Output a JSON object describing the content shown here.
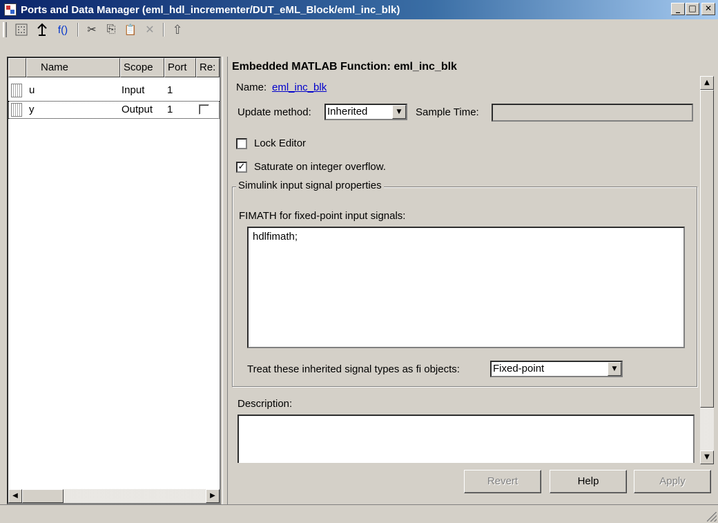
{
  "window": {
    "title": "Ports and Data Manager (eml_hdl_incrementer/DUT_eML_Block/eml_inc_blk)",
    "minimize": "_",
    "maximize": "□",
    "close": "✕"
  },
  "toolbar": {
    "grip_icon": "toolbar-grip",
    "add_data_icon": "add-data-icon",
    "add_signal_icon": "add-port-icon",
    "function_label": "f()",
    "cut_icon": "✂",
    "copy_icon": "⎘",
    "paste_icon": "📋",
    "delete_icon": "✕",
    "up_icon": "⇧"
  },
  "grid": {
    "columns": [
      "Name",
      "Scope",
      "Port",
      "Re:"
    ],
    "rows": [
      {
        "name": "u",
        "scope": "Input",
        "port": "1",
        "resolve": false
      },
      {
        "name": "y",
        "scope": "Output",
        "port": "1",
        "resolve": false
      }
    ]
  },
  "panel": {
    "title": "Embedded MATLAB Function: eml_inc_blk",
    "name_label": "Name:",
    "name_value": "eml_inc_blk",
    "update_method_label": "Update method:",
    "update_method_value": "Inherited",
    "sample_time_label": "Sample Time:",
    "sample_time_value": "",
    "lock_editor_label": "Lock Editor",
    "lock_editor_checked": false,
    "saturate_label": "Saturate on integer overflow.",
    "saturate_checked": true,
    "group_title": "Simulink input signal properties",
    "fimath_label": "FIMATH for fixed-point input signals:",
    "fimath_value": "hdlfimath;",
    "treat_label": "Treat these inherited signal types as fi objects:",
    "treat_value": "Fixed-point",
    "description_label": "Description:",
    "description_value": ""
  },
  "buttons": {
    "revert": "Revert",
    "help": "Help",
    "apply": "Apply"
  },
  "colors": {
    "face": "#d4d0c8",
    "title_active": "#0a246a",
    "link": "#0000cc"
  }
}
